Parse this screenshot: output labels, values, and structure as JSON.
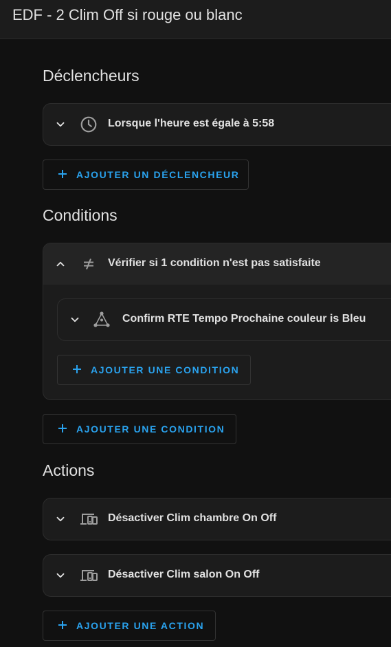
{
  "header": {
    "title": "EDF - 2 Clim Off si rouge ou blanc"
  },
  "triggers": {
    "heading": "Déclencheurs",
    "items": [
      {
        "label": "Lorsque l'heure est égale à 5:58",
        "icon": "clock-icon"
      }
    ],
    "add_label": "AJOUTER UN DÉCLENCHEUR"
  },
  "conditions": {
    "heading": "Conditions",
    "group": {
      "label": "Vérifier si 1 condition n'est pas satisfaite",
      "icon": "not-equal-icon",
      "children": [
        {
          "label": "Confirm RTE Tempo Prochaine couleur is Bleu",
          "icon": "state-graph-icon"
        }
      ],
      "add_label": "AJOUTER UNE CONDITION"
    },
    "add_label": "AJOUTER UNE CONDITION"
  },
  "actions": {
    "heading": "Actions",
    "items": [
      {
        "label": "Désactiver Clim chambre On Off",
        "icon": "devices-icon"
      },
      {
        "label": "Désactiver Clim salon On Off",
        "icon": "devices-icon"
      }
    ],
    "add_label": "AJOUTER UNE ACTION"
  },
  "colors": {
    "accent": "#2aa3ef",
    "background": "#111111",
    "card": "#1c1c1c",
    "text": "#e1e1e1",
    "icon": "#9e9e9e"
  }
}
